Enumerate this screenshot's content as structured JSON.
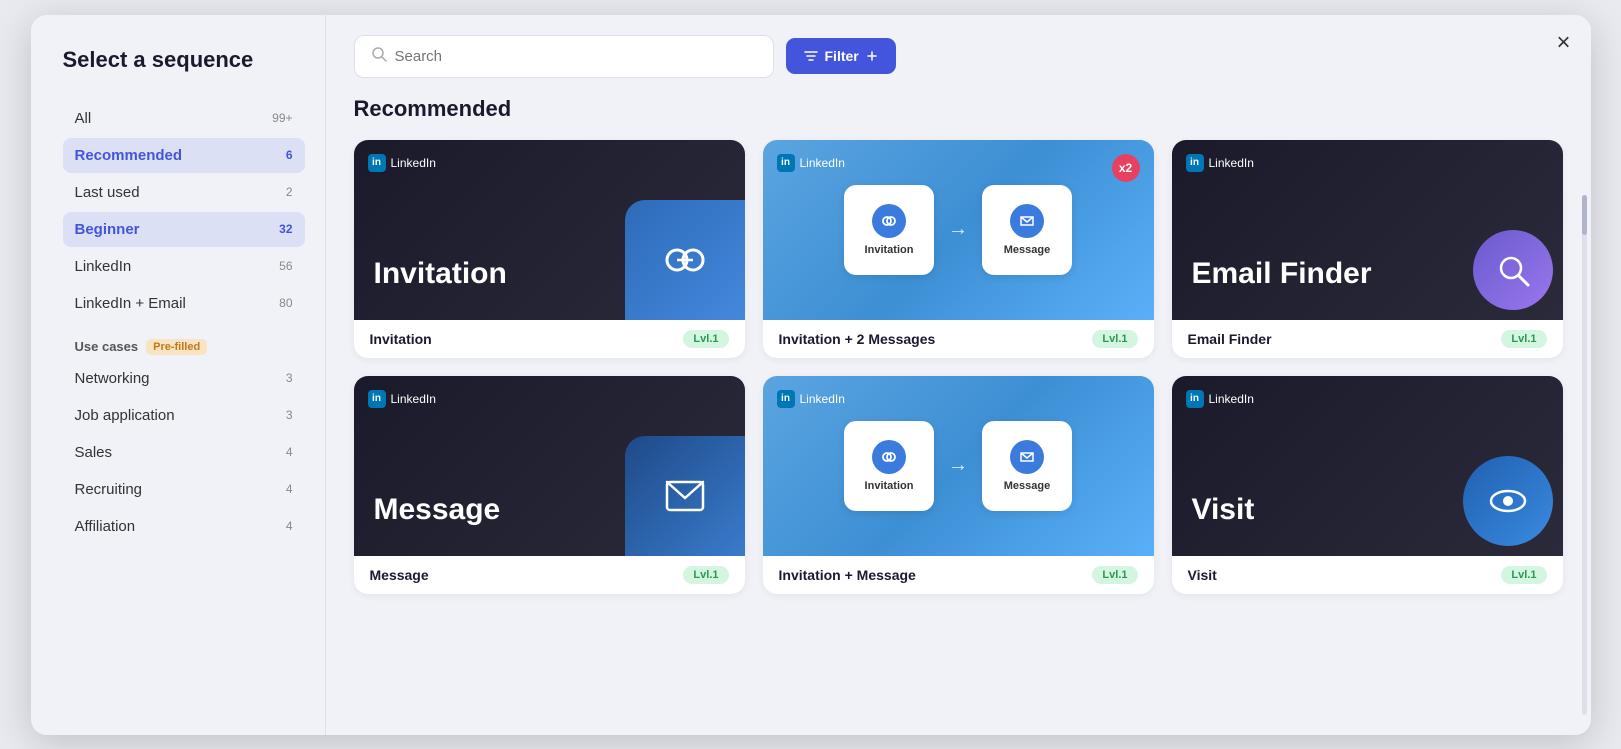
{
  "modal": {
    "title": "Select a sequence",
    "close_label": "×"
  },
  "sidebar": {
    "items": [
      {
        "id": "all",
        "label": "All",
        "badge": "99+",
        "active": false
      },
      {
        "id": "recommended",
        "label": "Recommended",
        "badge": "6",
        "active": true
      },
      {
        "id": "last-used",
        "label": "Last used",
        "badge": "2",
        "active": false
      },
      {
        "id": "beginner",
        "label": "Beginner",
        "badge": "32",
        "active": false
      },
      {
        "id": "linkedin",
        "label": "LinkedIn",
        "badge": "56",
        "active": false
      },
      {
        "id": "linkedin-email",
        "label": "LinkedIn + Email",
        "badge": "80",
        "active": false
      }
    ],
    "use_cases_label": "Use cases",
    "pre_filled_label": "Pre-filled",
    "use_case_items": [
      {
        "id": "networking",
        "label": "Networking",
        "badge": "3"
      },
      {
        "id": "job-application",
        "label": "Job application",
        "badge": "3"
      },
      {
        "id": "sales",
        "label": "Sales",
        "badge": "4"
      },
      {
        "id": "recruiting",
        "label": "Recruiting",
        "badge": "4"
      },
      {
        "id": "affiliation",
        "label": "Affiliation",
        "badge": "4"
      }
    ]
  },
  "topbar": {
    "search_placeholder": "Search",
    "filter_label": "Filter"
  },
  "main": {
    "section_heading": "Recommended",
    "cards": [
      {
        "id": "invitation",
        "name": "Invitation",
        "level": "Lvl.1",
        "theme": "dark",
        "type": "single",
        "preview_title": "Invitation",
        "icon": "🔗",
        "linkedin_label": "LinkedIn"
      },
      {
        "id": "invitation-2-messages",
        "name": "Invitation + 2 Messages",
        "level": "Lvl.1",
        "theme": "blue",
        "type": "two-step",
        "step1": "Invitation",
        "step2": "Message",
        "linkedin_label": "LinkedIn",
        "badge": "x2"
      },
      {
        "id": "email-finder",
        "name": "Email Finder",
        "level": "Lvl.1",
        "theme": "dark",
        "type": "single",
        "preview_title": "Email Finder",
        "icon": "🔍",
        "linkedin_label": "LinkedIn"
      },
      {
        "id": "message",
        "name": "Message",
        "level": "Lvl.1",
        "theme": "dark",
        "type": "single",
        "preview_title": "Message",
        "icon": "✉",
        "linkedin_label": "LinkedIn"
      },
      {
        "id": "invitation-message",
        "name": "Invitation + Message",
        "level": "Lvl.1",
        "theme": "blue",
        "type": "two-step",
        "step1": "Invitation",
        "step2": "Message",
        "linkedin_label": "LinkedIn"
      },
      {
        "id": "visit",
        "name": "Visit",
        "level": "Lvl.1",
        "theme": "dark",
        "type": "single",
        "preview_title": "Visit",
        "icon": "👁",
        "linkedin_label": "LinkedIn"
      }
    ]
  }
}
